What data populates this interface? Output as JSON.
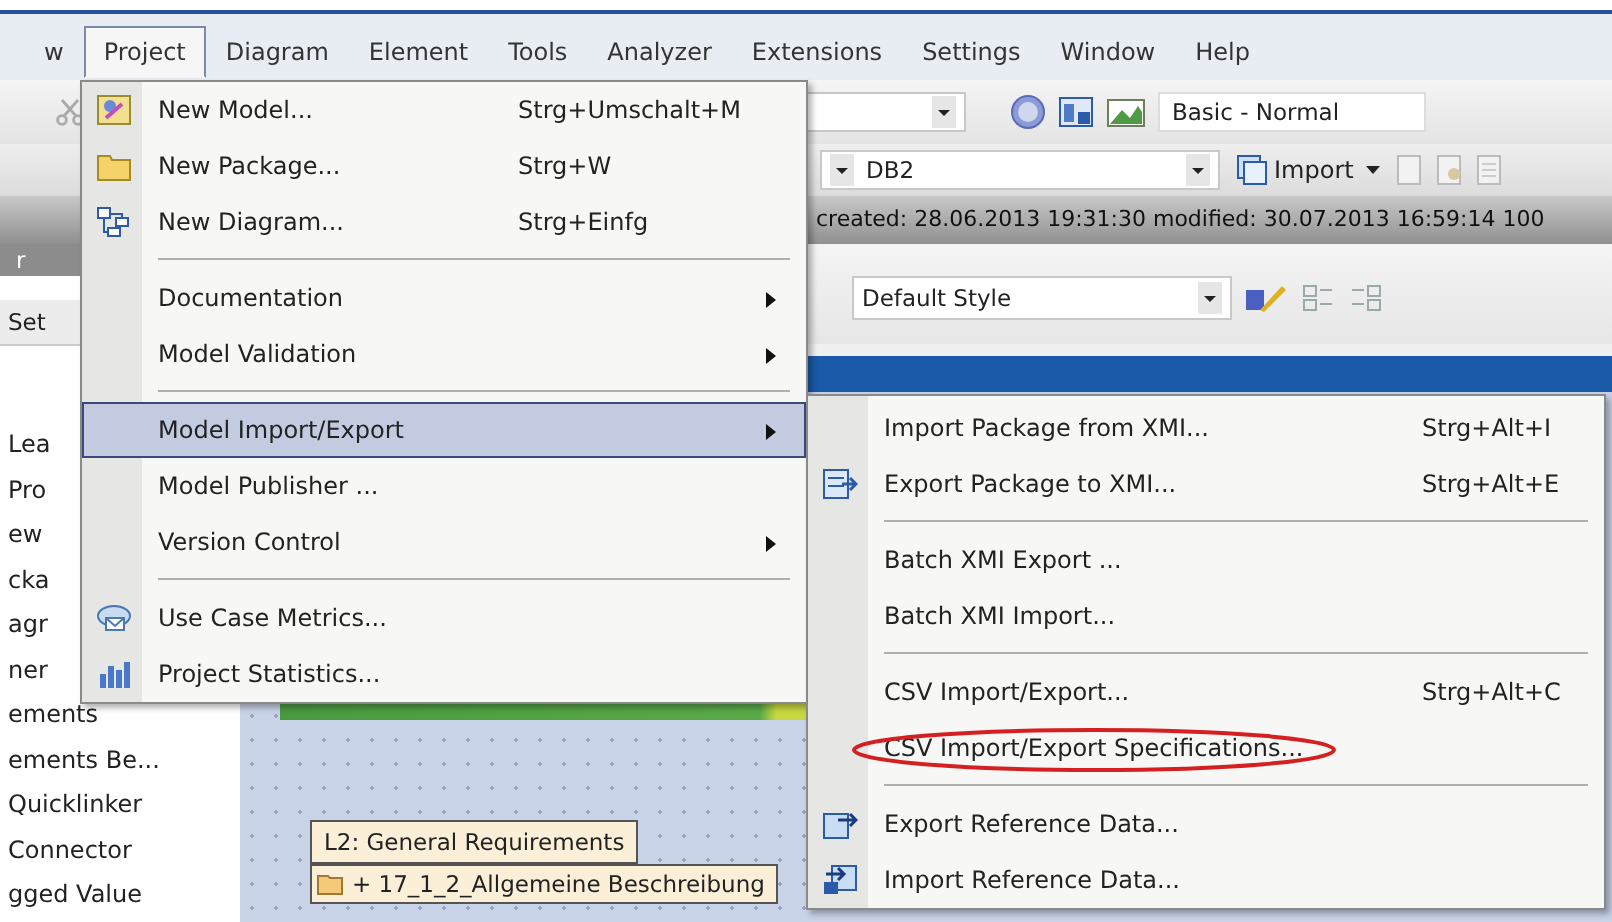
{
  "menu_bar": [
    {
      "label": "w",
      "selected": false
    },
    {
      "label": "Project",
      "selected": true
    },
    {
      "label": "Diagram",
      "selected": false
    },
    {
      "label": "Element",
      "selected": false
    },
    {
      "label": "Tools",
      "selected": false
    },
    {
      "label": "Analyzer",
      "selected": false
    },
    {
      "label": "Extensions",
      "selected": false
    },
    {
      "label": "Settings",
      "selected": false
    },
    {
      "label": "Window",
      "selected": false
    },
    {
      "label": "Help",
      "selected": false
    }
  ],
  "toolbar": {
    "perspective": "Basic - Normal",
    "database": "DB2",
    "import_button": "Import",
    "style": "Default Style"
  },
  "status_line": "created: 28.06.2013 19:31:30  modified: 30.07.2013 16:59:14  100",
  "left_panel": {
    "header": "r",
    "tab": "Set",
    "items": [
      "Lea",
      "Pro",
      "ew",
      "cka",
      "agr",
      "ner",
      "ements",
      "ements Be...",
      "Quicklinker",
      "Connector",
      "gged Value"
    ]
  },
  "diagram": {
    "frame_title": "L2: General Requirements",
    "package": "+ 17_1_2_Allgemeine Beschreibung"
  },
  "project_menu": [
    {
      "kind": "item",
      "label": "New Model...",
      "shortcut": "Strg+Umschalt+M",
      "submenu": false,
      "selected": false
    },
    {
      "kind": "item",
      "label": "New Package...",
      "shortcut": "Strg+W",
      "submenu": false,
      "selected": false
    },
    {
      "kind": "item",
      "label": "New Diagram...",
      "shortcut": "Strg+Einfg",
      "submenu": false,
      "selected": false
    },
    {
      "kind": "separator"
    },
    {
      "kind": "item",
      "label": "Documentation",
      "submenu": true,
      "selected": false
    },
    {
      "kind": "item",
      "label": "Model Validation",
      "submenu": true,
      "selected": false
    },
    {
      "kind": "separator"
    },
    {
      "kind": "item",
      "label": "Model Import/Export",
      "submenu": true,
      "selected": true
    },
    {
      "kind": "item",
      "label": "Model Publisher ...",
      "submenu": false,
      "selected": false
    },
    {
      "kind": "item",
      "label": "Version Control",
      "submenu": true,
      "selected": false
    },
    {
      "kind": "separator"
    },
    {
      "kind": "item",
      "label": "Use Case Metrics...",
      "submenu": false,
      "selected": false
    },
    {
      "kind": "item",
      "label": "Project Statistics...",
      "submenu": false,
      "selected": false
    }
  ],
  "submenu": [
    {
      "kind": "item",
      "label": "Import Package from XMI...",
      "shortcut": "Strg+Alt+I",
      "circled": false
    },
    {
      "kind": "item",
      "label": "Export Package to XMI...",
      "shortcut": "Strg+Alt+E",
      "circled": false
    },
    {
      "kind": "separator"
    },
    {
      "kind": "item",
      "label": "Batch XMI Export ...",
      "circled": false
    },
    {
      "kind": "item",
      "label": "Batch XMI Import...",
      "circled": false
    },
    {
      "kind": "separator"
    },
    {
      "kind": "item",
      "label": "CSV Import/Export...",
      "shortcut": "Strg+Alt+C",
      "circled": false
    },
    {
      "kind": "item",
      "label": "CSV Import/Export Specifications...",
      "circled": true
    },
    {
      "kind": "separator"
    },
    {
      "kind": "item",
      "label": "Export Reference Data...",
      "circled": false
    },
    {
      "kind": "item",
      "label": "Import Reference Data...",
      "circled": false
    }
  ]
}
